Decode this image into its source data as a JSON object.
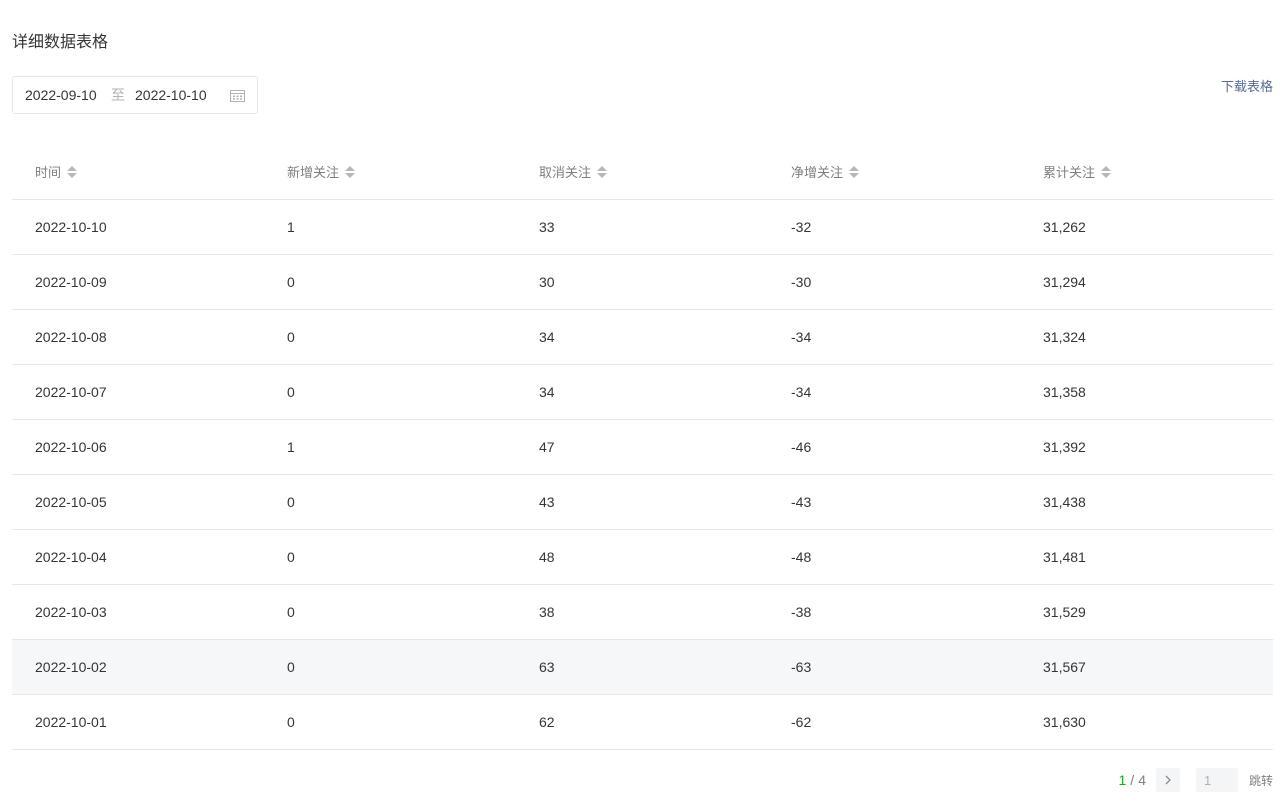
{
  "section": {
    "title": "详细数据表格"
  },
  "date_range": {
    "start": "2022-09-10",
    "separator": "至",
    "end": "2022-10-10",
    "icon": "calendar-icon"
  },
  "download": {
    "label": "下载表格"
  },
  "table": {
    "columns": [
      "时间",
      "新增关注",
      "取消关注",
      "净增关注",
      "累计关注"
    ],
    "rows": [
      [
        "2022-10-10",
        "1",
        "33",
        "-32",
        "31,262"
      ],
      [
        "2022-10-09",
        "0",
        "30",
        "-30",
        "31,294"
      ],
      [
        "2022-10-08",
        "0",
        "34",
        "-34",
        "31,324"
      ],
      [
        "2022-10-07",
        "0",
        "34",
        "-34",
        "31,358"
      ],
      [
        "2022-10-06",
        "1",
        "47",
        "-46",
        "31,392"
      ],
      [
        "2022-10-05",
        "0",
        "43",
        "-43",
        "31,438"
      ],
      [
        "2022-10-04",
        "0",
        "48",
        "-48",
        "31,481"
      ],
      [
        "2022-10-03",
        "0",
        "38",
        "-38",
        "31,529"
      ],
      [
        "2022-10-02",
        "0",
        "63",
        "-63",
        "31,567"
      ],
      [
        "2022-10-01",
        "0",
        "62",
        "-62",
        "31,630"
      ]
    ],
    "highlighted_row": 8
  },
  "pagination": {
    "current": "1",
    "separator": "/",
    "total": "4",
    "next_icon": "chevron-right-icon",
    "jump_placeholder": "1",
    "jump_label": "跳转"
  },
  "colors": {
    "accent": "#1aad19",
    "link": "#576b95",
    "border": "#e7e7eb",
    "highlight": "#f6f7f9"
  }
}
